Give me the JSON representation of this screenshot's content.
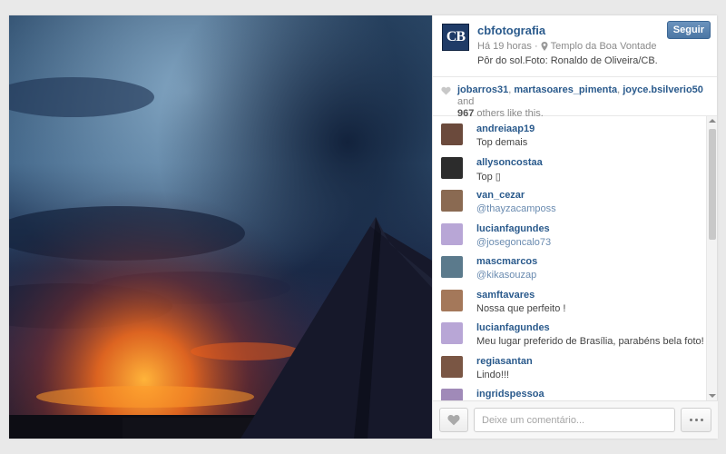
{
  "post": {
    "owner": "cbfotografia",
    "avatar_text": "CB",
    "time": "Há 19 horas ·",
    "location": "Templo da Boa Vontade",
    "caption": "Pôr do sol.Foto: Ronaldo de Oliveira/CB.",
    "follow_label": "Seguir"
  },
  "likes": {
    "users": [
      "jobarros31",
      "martasoares_pimenta",
      "joyce.bsilverio50"
    ],
    "sep": ", ",
    "and_text": " and",
    "count": "967",
    "suffix": " others like this."
  },
  "comments": [
    {
      "user": "andreiaap19",
      "text": "Top demais",
      "mention": false,
      "avatar_color": "#6b4a3c"
    },
    {
      "user": "allysoncostaa",
      "text": "Top ▯",
      "mention": false,
      "avatar_color": "#2c2c2c"
    },
    {
      "user": "van_cezar",
      "text": "@thayzacamposs",
      "mention": true,
      "avatar_color": "#8a6a52"
    },
    {
      "user": "lucianfagundes",
      "text": "@josegoncalo73",
      "mention": true,
      "avatar_color": "#b8a6d6"
    },
    {
      "user": "mascmarcos",
      "text": "@kikasouzap",
      "mention": true,
      "avatar_color": "#5b7a8c"
    },
    {
      "user": "samftavares",
      "text": "Nossa que perfeito !",
      "mention": false,
      "avatar_color": "#a4785a"
    },
    {
      "user": "lucianfagundes",
      "text": "Meu lugar preferido de Brasília, parabéns bela foto!",
      "mention": false,
      "avatar_color": "#b8a6d6"
    },
    {
      "user": "regiasantan",
      "text": "Lindo!!!",
      "mention": false,
      "avatar_color": "#7a5644"
    },
    {
      "user": "ingridspessoa",
      "text": "",
      "mention": false,
      "avatar_color": "#a08ab8"
    }
  ],
  "footer": {
    "comment_placeholder": "Deixe um comentário..."
  },
  "colors": {
    "link": "#2a5a8c",
    "follow_button": "#4e7aa8"
  },
  "icons": [
    "pin-icon",
    "heart-icon",
    "more-icon"
  ]
}
